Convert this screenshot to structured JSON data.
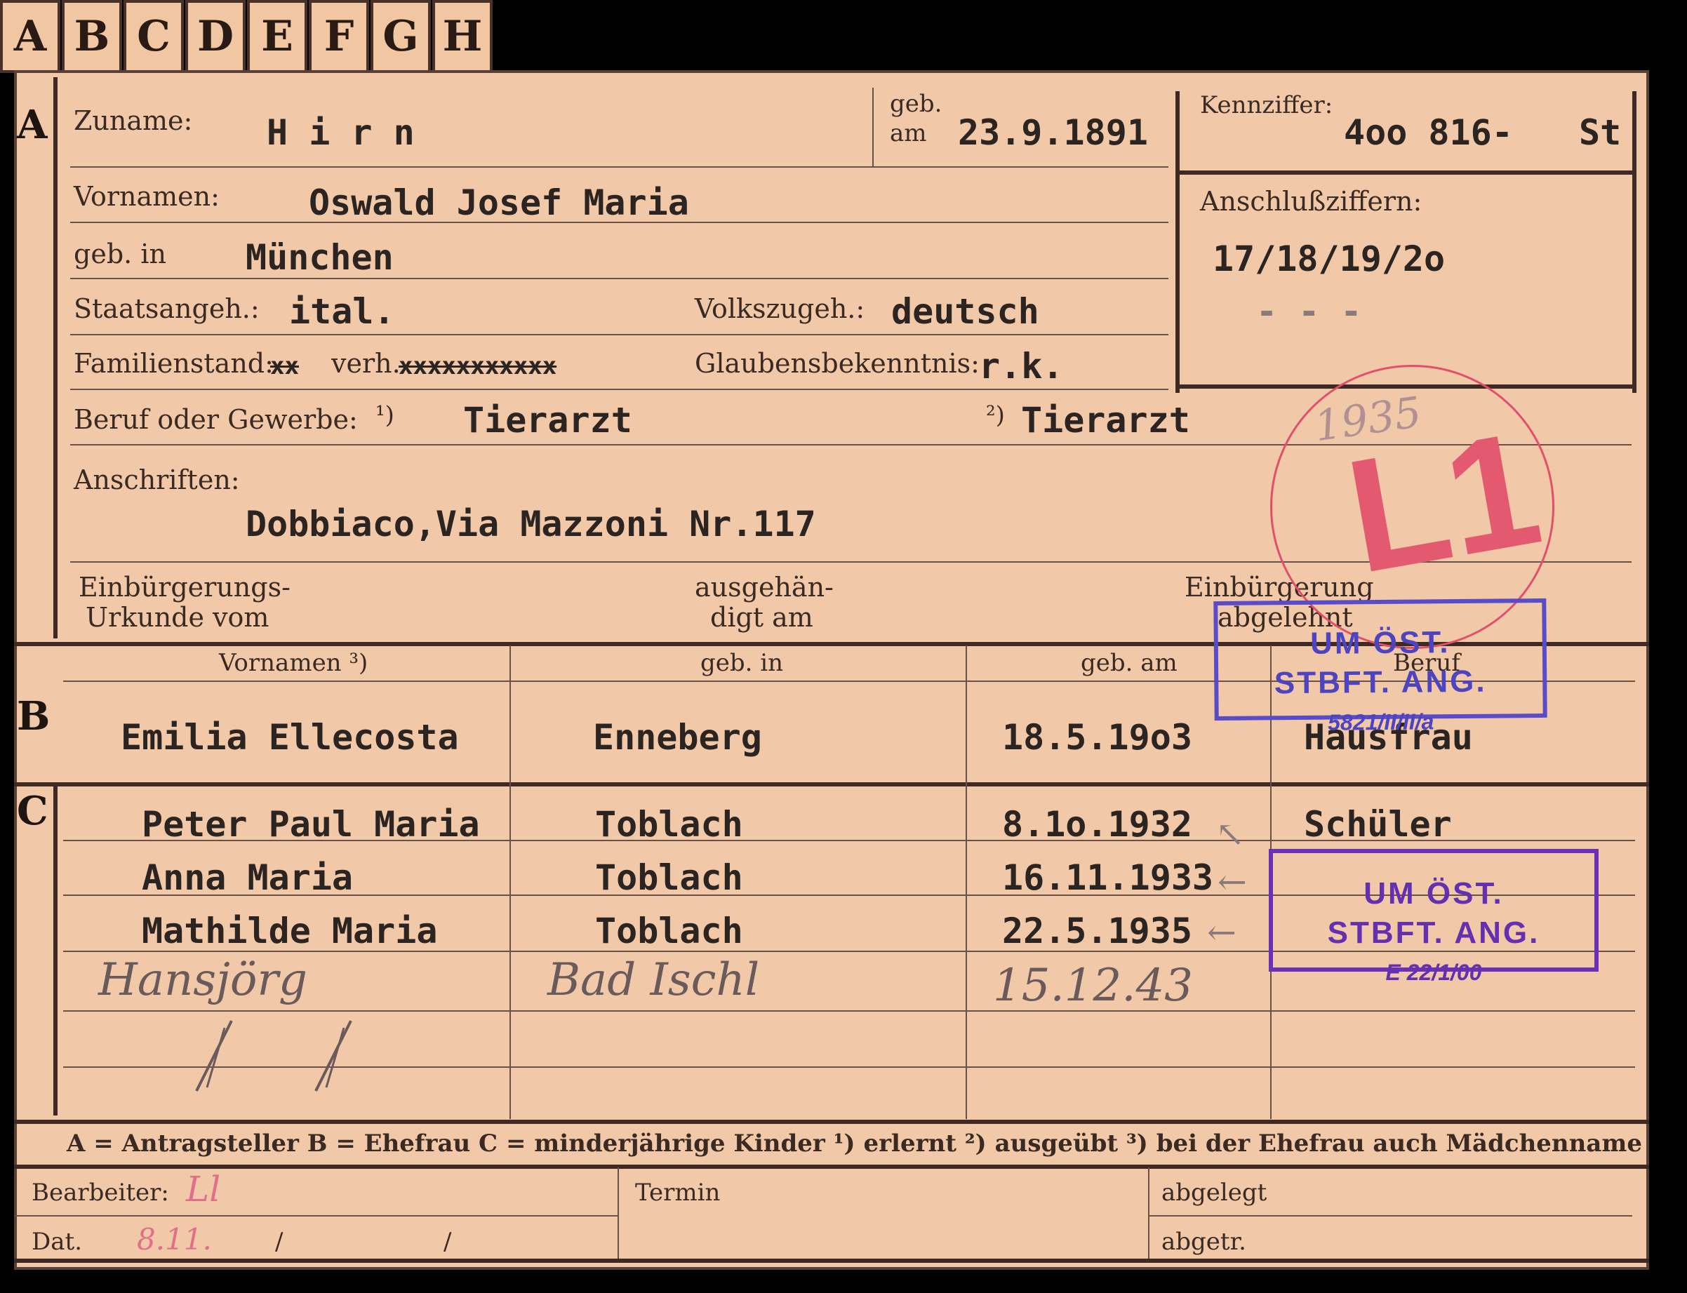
{
  "tabs": [
    "A",
    "B",
    "C",
    "D",
    "E",
    "F",
    "G",
    "H"
  ],
  "sections": {
    "a": "A",
    "b": "B",
    "c": "C"
  },
  "a": {
    "zuname_label": "Zuname:",
    "zuname": "H i r n",
    "geb_label1": "geb.",
    "geb_label2": "am",
    "geb_am": "23.9.1891",
    "kennziffer_label": "Kennziffer:",
    "kennziffer": "4oo 816-",
    "kennziffer_suffix": "St",
    "anschluss_label": "Anschlußziffern:",
    "anschluss": "17/18/19/2o",
    "anschluss_dashes": "-   -   -",
    "vornamen_label": "Vornamen:",
    "vornamen": "Oswald Josef Maria",
    "geb_in_label": "geb. in",
    "geb_in": "München",
    "staats_label": "Staatsangeh.:",
    "staats": "ital.",
    "volks_label": "Volkszugeh.:",
    "volks": "deutsch",
    "familien_label": "Familienstand:",
    "familien_strike1": "xx",
    "familien_verh": "verh.",
    "familien_strike2": "xxxxxxxxxxx",
    "glauben_label": "Glaubensbekenntnis:",
    "glauben": "r.k.",
    "beruf_label": "Beruf oder Gewerbe:",
    "beruf_note1": "¹)",
    "beruf1": "Tierarzt",
    "beruf_note2": "²)",
    "beruf2": "Tierarzt",
    "anschriften_label": "Anschriften:",
    "anschrift": "Dobbiaco,Via Mazzoni Nr.117",
    "einb_label1": "Einbürgerungs-",
    "einb_label2": "Urkunde vom",
    "ausg_label1": "ausgehän-",
    "ausg_label2": "digt am",
    "abgelehnt_label1": "Einbürgerung",
    "abgelehnt_label2": "abgelehnt"
  },
  "b": {
    "headers": [
      "Vornamen ³)",
      "geb. in",
      "geb. am",
      "Beruf"
    ],
    "row": [
      "Emilia Ellecosta",
      "Enneberg",
      "18.5.19o3",
      "Hausfrau"
    ]
  },
  "c": {
    "rows": [
      [
        "Peter Paul Maria",
        "Toblach",
        "8.1o.1932",
        "Schüler"
      ],
      [
        "Anna Maria",
        "Toblach",
        "16.11.1933",
        ""
      ],
      [
        "Mathilde Maria",
        "Toblach",
        "22.5.1935",
        ""
      ]
    ],
    "handwritten": [
      "Hansjörg",
      "Bad Ischl",
      "15.12.43"
    ]
  },
  "legend": "A = Antragsteller   B = Ehefrau   C = minderjährige Kinder   ¹) erlernt   ²) ausgeübt   ³) bei der Ehefrau auch Mädchenname",
  "footer": {
    "bearbeiter_label": "Bearbeiter:",
    "bearbeiter_value": "Ll",
    "termin_label": "Termin",
    "abgelegt_label": "abgelegt",
    "dat_label": "Dat.",
    "dat_value": "8.11.",
    "dat_sep1": "/",
    "dat_sep2": "/",
    "abgetr_label": "abgetr."
  },
  "stamps": {
    "red_year": "1935",
    "red_code": "L1",
    "blue_line1": "UM ÖST.",
    "blue_line2": "STBFT. ANG.",
    "blue_ref": "5821/II/II/a",
    "purple_line1": "UM ÖST.",
    "purple_line2": "STBFT. ANG.",
    "purple_ref": "E 22/1/00"
  },
  "colors": {
    "paper": "#f2c9a8",
    "red_stamp": "#e35a70",
    "blue_stamp": "#4e44c0",
    "purple_stamp": "#6430b0"
  }
}
